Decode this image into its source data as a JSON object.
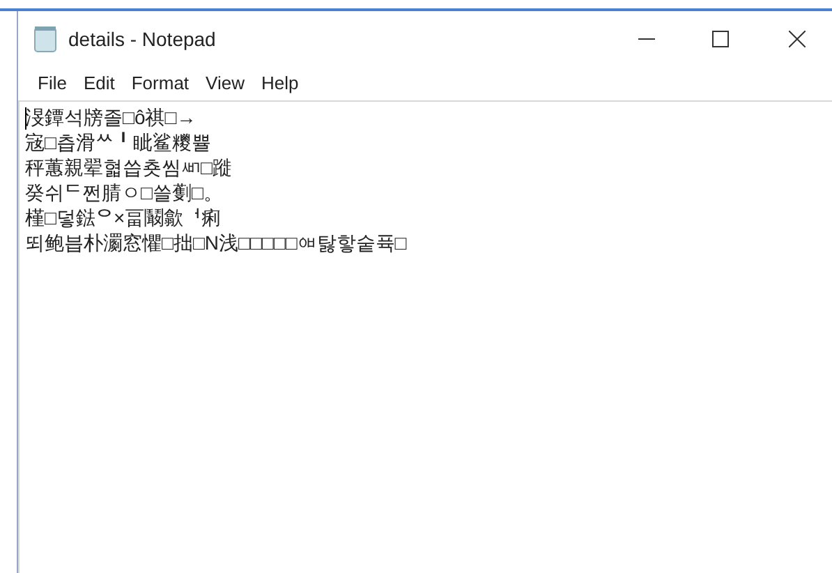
{
  "window": {
    "title": "details - Notepad"
  },
  "menu": [
    "File",
    "Edit",
    "Format",
    "View",
    "Help"
  ],
  "lines": [
    "渂鐔석牓졸□ô祺□→",
    "宼□츱滑ᄊ╹眦鲨糭쁄",
    "秤蕙親翚혋씁춋씸ᄳ□蹝",
    "癸쉬ᄃ쩐腈ㅇ□쓸劐□。",
    "槿□덯鍅ᄋ×畐鬫歙ᅥ痢",
    "뙤鲍븝朴瀱窓懼□拙□N浅□□□□□ᅄ탏핳숱퓩□"
  ]
}
